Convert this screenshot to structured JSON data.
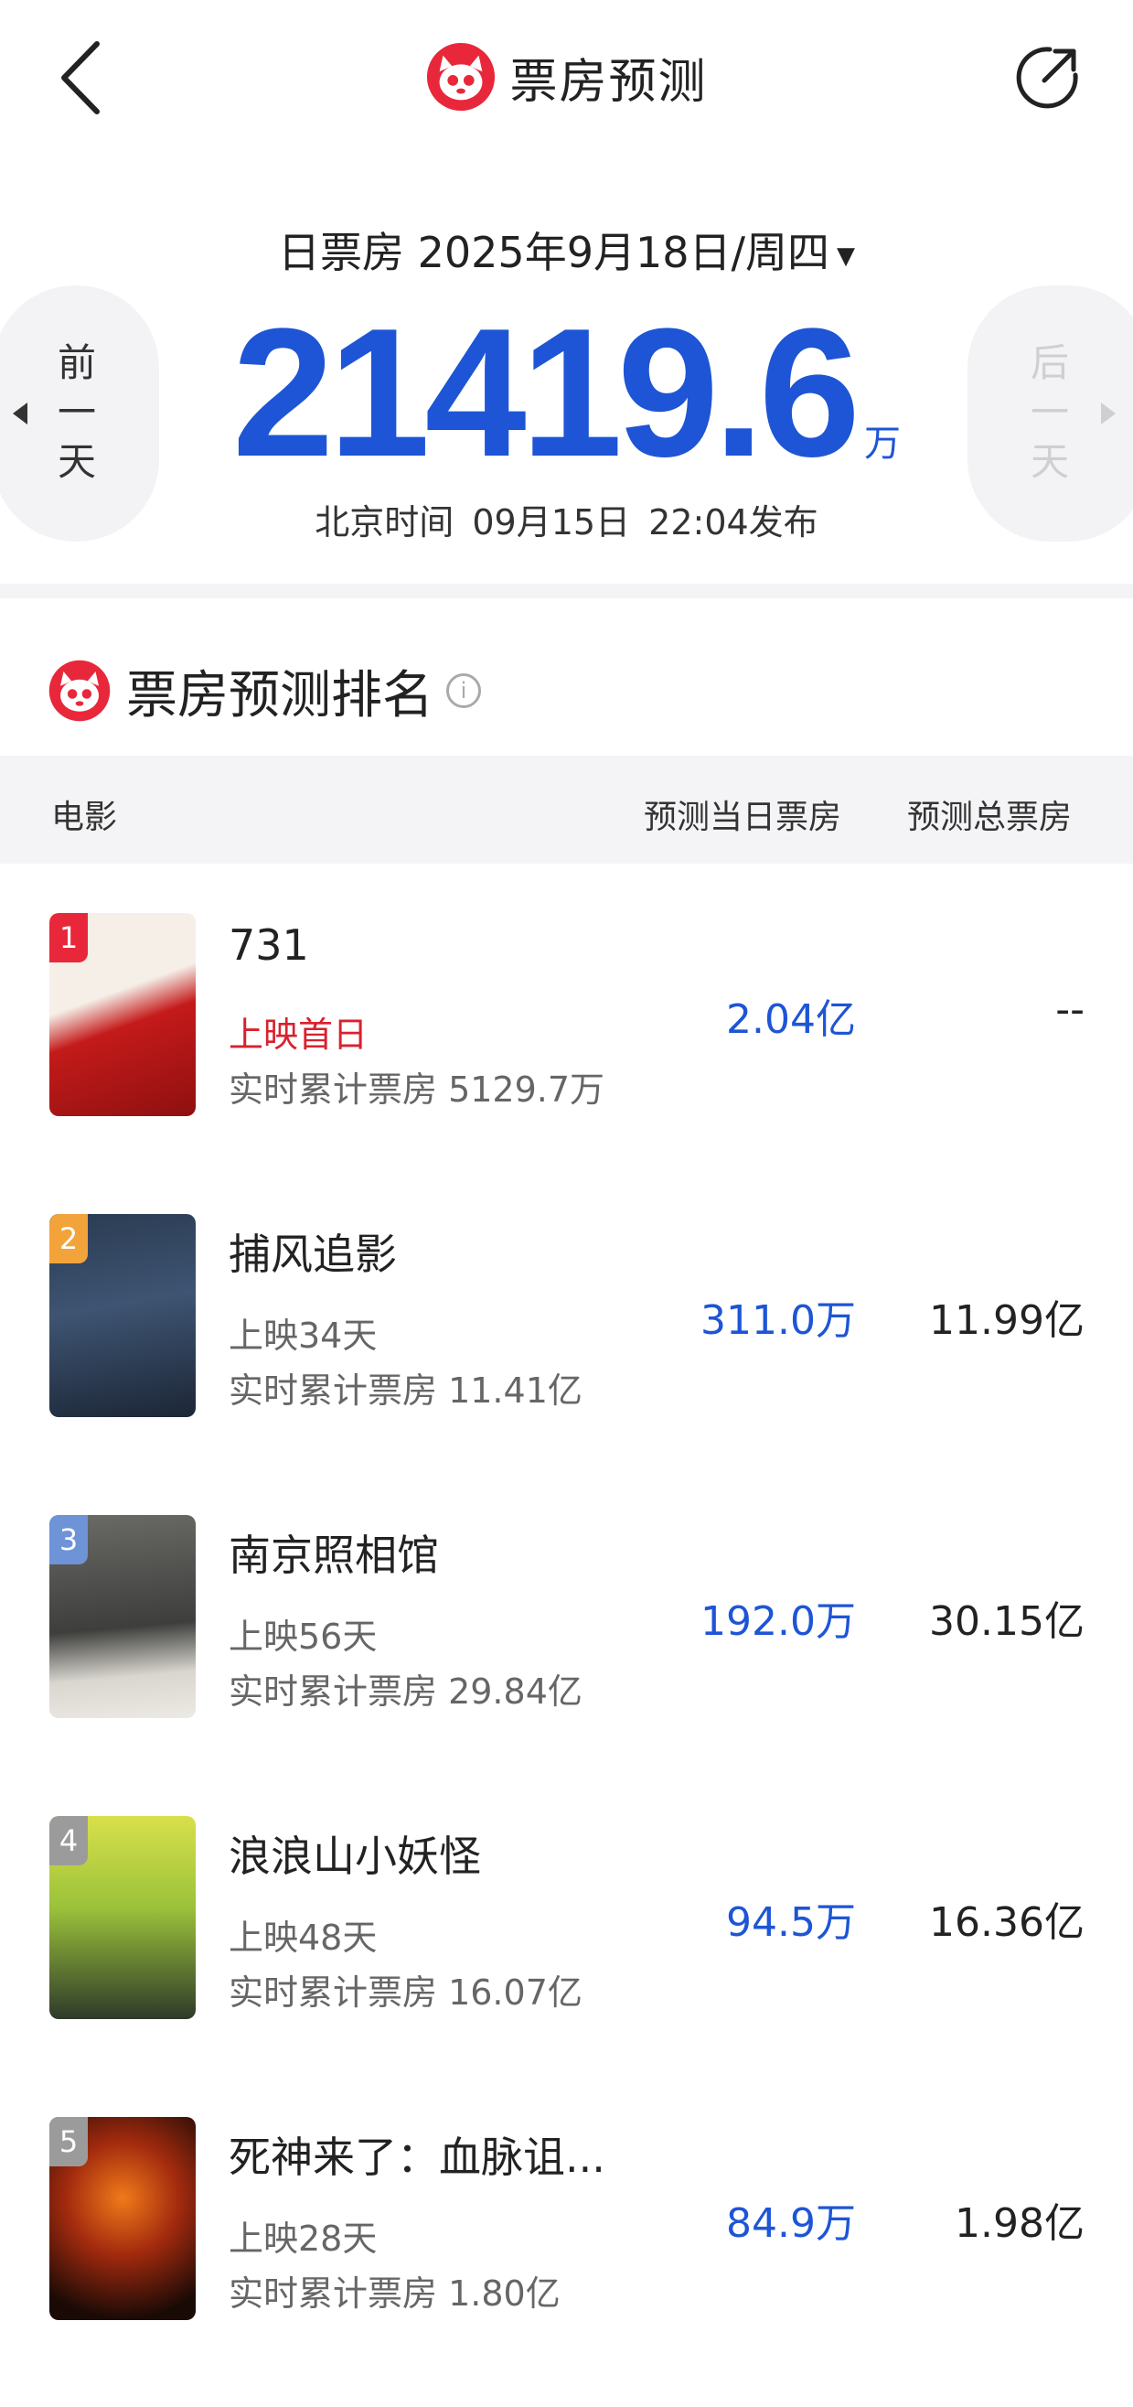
{
  "header": {
    "title": "票房预测"
  },
  "summary": {
    "date_label": "日票房 2025年9月18日/周四",
    "total_value": "21419.6",
    "total_unit": "万",
    "publish_time": "北京时间 09月15日 22:04发布",
    "prev_day": [
      "前",
      "一",
      "天"
    ],
    "next_day": [
      "后",
      "一",
      "天"
    ]
  },
  "ranking": {
    "title": "票房预测排名",
    "col_movie": "电影",
    "col_daily": "预测当日票房",
    "col_total": "预测总票房"
  },
  "movies": [
    {
      "rank": "1",
      "name": "731",
      "status": "上映首日",
      "cumulative": "实时累计票房 5129.7万",
      "pred_daily": "2.04亿",
      "pred_total": "--",
      "badge_color": "#e8283a"
    },
    {
      "rank": "2",
      "name": "捕风追影",
      "status": "上映34天",
      "cumulative": "实时累计票房 11.41亿",
      "pred_daily": "311.0万",
      "pred_total": "11.99亿",
      "badge_color": "#f2a33a"
    },
    {
      "rank": "3",
      "name": "南京照相馆",
      "status": "上映56天",
      "cumulative": "实时累计票房 29.84亿",
      "pred_daily": "192.0万",
      "pred_total": "30.15亿",
      "badge_color": "#6e93d6"
    },
    {
      "rank": "4",
      "name": "浪浪山小妖怪",
      "status": "上映48天",
      "cumulative": "实时累计票房 16.07亿",
      "pred_daily": "94.5万",
      "pred_total": "16.36亿",
      "badge_color": "#9b9b9b"
    },
    {
      "rank": "5",
      "name": "死神来了：血脉诅...",
      "status": "上映28天",
      "cumulative": "实时累计票房 1.80亿",
      "pred_daily": "84.9万",
      "pred_total": "1.98亿",
      "badge_color": "#9b9b9b"
    }
  ]
}
